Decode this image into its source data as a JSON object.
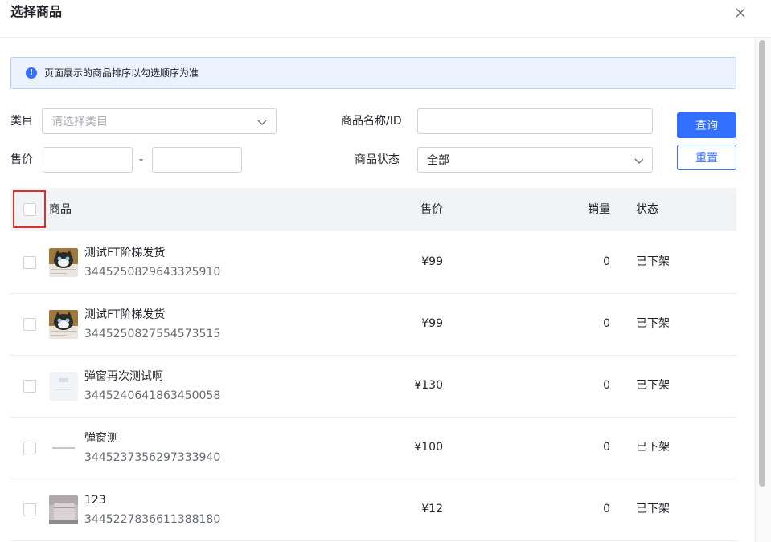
{
  "dialog": {
    "title": "选择商品"
  },
  "notice": {
    "text": "页面展示的商品排序以勾选顺序为准"
  },
  "filters": {
    "category_label": "类目",
    "category_placeholder": "请选择类目",
    "name_label": "商品名称/ID",
    "name_value": "",
    "price_label": "售价",
    "price_min": "",
    "price_max": "",
    "price_separator": "-",
    "status_label": "商品状态",
    "status_value": "全部"
  },
  "buttons": {
    "query": "查询",
    "reset": "重置"
  },
  "table": {
    "columns": {
      "product": "商品",
      "price": "售价",
      "sales": "销量",
      "status": "状态"
    },
    "rows": [
      {
        "name": "测试FT阶梯发货",
        "id": "3445250829643325910",
        "price": "¥99",
        "sales": "0",
        "status": "已下架",
        "thumb": "cat-image"
      },
      {
        "name": "测试FT阶梯发货",
        "id": "3445250827554573515",
        "price": "¥99",
        "sales": "0",
        "status": "已下架",
        "thumb": "cat-image"
      },
      {
        "name": "弹窗再次测试啊",
        "id": "3445240641863450058",
        "price": "¥130",
        "sales": "0",
        "status": "已下架",
        "thumb": "light-card-image"
      },
      {
        "name": "弹窗测",
        "id": "3445237356297333940",
        "price": "¥100",
        "sales": "0",
        "status": "已下架",
        "thumb": "line-image"
      },
      {
        "name": "123",
        "id": "3445227836611388180",
        "price": "¥12",
        "sales": "0",
        "status": "已下架",
        "thumb": "device-image"
      }
    ]
  },
  "colors": {
    "primary": "#3370ff",
    "highlight": "#e0302b",
    "notice_bg": "#ebf1fd"
  }
}
